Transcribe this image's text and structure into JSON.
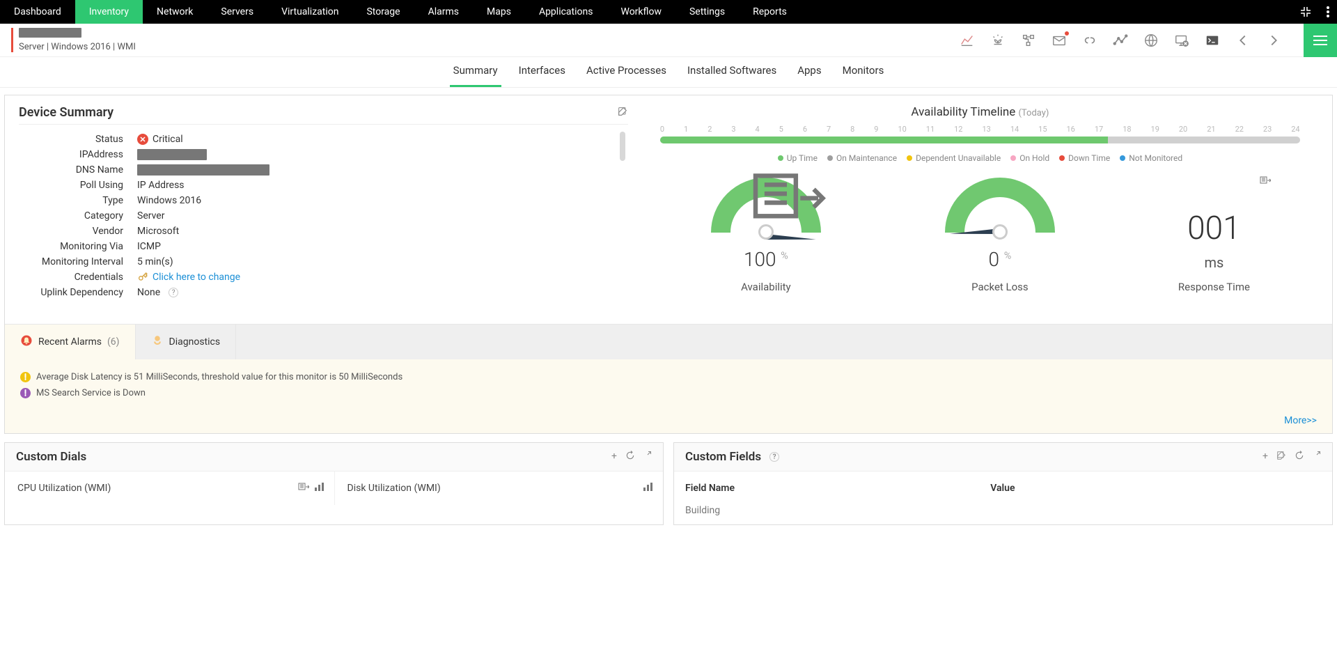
{
  "nav": {
    "items": [
      "Dashboard",
      "Inventory",
      "Network",
      "Servers",
      "Virtualization",
      "Storage",
      "Alarms",
      "Maps",
      "Applications",
      "Workflow",
      "Settings",
      "Reports"
    ],
    "active_index": 1
  },
  "identity": {
    "sub": "Server  |  Windows 2016   |  WMI"
  },
  "tabs": {
    "items": [
      "Summary",
      "Interfaces",
      "Active Processes",
      "Installed Softwares",
      "Apps",
      "Monitors"
    ],
    "active_index": 0
  },
  "summary": {
    "title": "Device Summary",
    "rows": {
      "status_label": "Status",
      "status_value": "Critical",
      "ip_label": "IPAddress",
      "dns_label": "DNS Name",
      "poll_label": "Poll Using",
      "poll_value": "IP Address",
      "type_label": "Type",
      "type_value": "Windows 2016",
      "category_label": "Category",
      "category_value": "Server",
      "vendor_label": "Vendor",
      "vendor_value": "Microsoft",
      "monvia_label": "Monitoring Via",
      "monvia_value": "ICMP",
      "moninterval_label": "Monitoring Interval",
      "moninterval_value": "5 min(s)",
      "creds_label": "Credentials",
      "creds_link": "Click here to change",
      "uplink_label": "Uplink Dependency",
      "uplink_value": "None"
    }
  },
  "availability": {
    "title": "Availability Timeline",
    "subtitle": "(Today)",
    "hours": [
      "0",
      "1",
      "2",
      "3",
      "4",
      "5",
      "6",
      "7",
      "8",
      "9",
      "10",
      "11",
      "12",
      "13",
      "14",
      "15",
      "16",
      "17",
      "18",
      "19",
      "20",
      "21",
      "22",
      "23",
      "24"
    ],
    "up_percent": 70,
    "legend": [
      {
        "label": "Up Time",
        "color": "#6EC86E"
      },
      {
        "label": "On Maintenance",
        "color": "#9E9E9E"
      },
      {
        "label": "Dependent Unavailable",
        "color": "#F1C40F"
      },
      {
        "label": "On Hold",
        "color": "#F7A6C2"
      },
      {
        "label": "Down Time",
        "color": "#E74C3C"
      },
      {
        "label": "Not Monitored",
        "color": "#3498DB"
      }
    ],
    "gauges": {
      "availability": {
        "value": "100",
        "unit": "%",
        "label": "Availability"
      },
      "packet_loss": {
        "value": "0",
        "unit": "%",
        "label": "Packet Loss"
      },
      "response_time": {
        "value": "001",
        "unit": "ms",
        "label": "Response Time"
      }
    }
  },
  "alarms": {
    "tab_recent": "Recent Alarms",
    "count": "(6)",
    "tab_diag": "Diagnostics",
    "items": [
      {
        "severity_color": "#F1C40F",
        "text": "Average Disk Latency is 51 MilliSeconds, threshold value for this monitor is 50 MilliSeconds"
      },
      {
        "severity_color": "#9B59B6",
        "text": "MS Search Service is Down"
      }
    ],
    "more": "More>>"
  },
  "custom_dials": {
    "title": "Custom Dials",
    "items": [
      {
        "label": "CPU Utilization (WMI)"
      },
      {
        "label": "Disk Utilization (WMI)"
      }
    ]
  },
  "custom_fields": {
    "title": "Custom Fields",
    "col1": "Field Name",
    "col2": "Value",
    "rows": [
      {
        "name": "Building"
      }
    ]
  }
}
